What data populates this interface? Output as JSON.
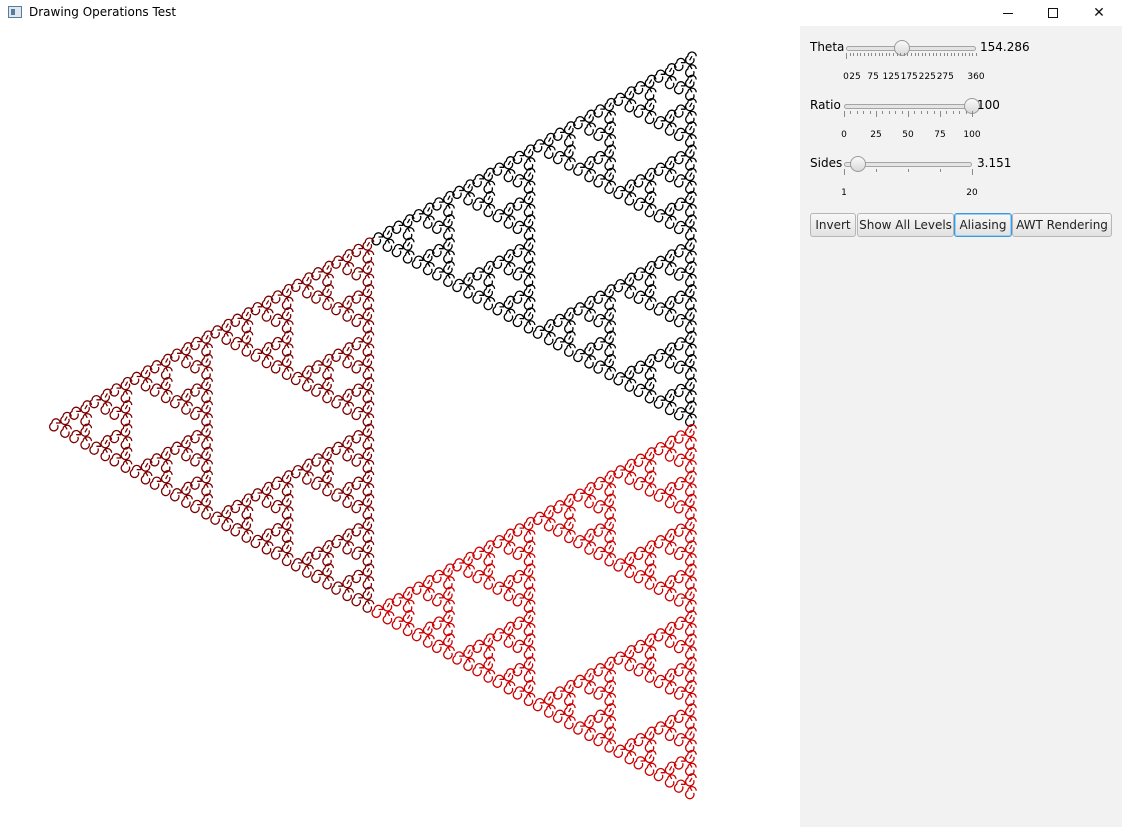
{
  "window": {
    "title": "Drawing Operations Test",
    "controls": {
      "minimize_icon": "minimize-icon",
      "maximize_icon": "maximize-icon",
      "close_icon": "close-icon",
      "close_glyph": "✕"
    }
  },
  "controls": {
    "theta": {
      "label": "Theta",
      "value_text": "154.286",
      "value": 154.286,
      "min": 0,
      "max": 360,
      "tick_labels": [
        "0",
        "25",
        "75",
        "125",
        "175",
        "225",
        "275",
        "360"
      ]
    },
    "ratio": {
      "label": "Ratio",
      "value_text": "100",
      "value": 100,
      "min": 0,
      "max": 100,
      "tick_labels": [
        "0",
        "25",
        "50",
        "75",
        "100"
      ]
    },
    "sides": {
      "label": "Sides",
      "value_text": "3.151",
      "value": 3.151,
      "min": 1,
      "max": 20,
      "tick_labels": [
        "1",
        "20"
      ]
    }
  },
  "buttons": {
    "invert": "Invert",
    "show_all_levels": "Show All Levels",
    "aliasing": "Aliasing",
    "awt_rendering": "AWT Rendering"
  },
  "fractal": {
    "colors": {
      "black": "#000000",
      "dark_red": "#7a0000",
      "red": "#cc0000"
    }
  }
}
